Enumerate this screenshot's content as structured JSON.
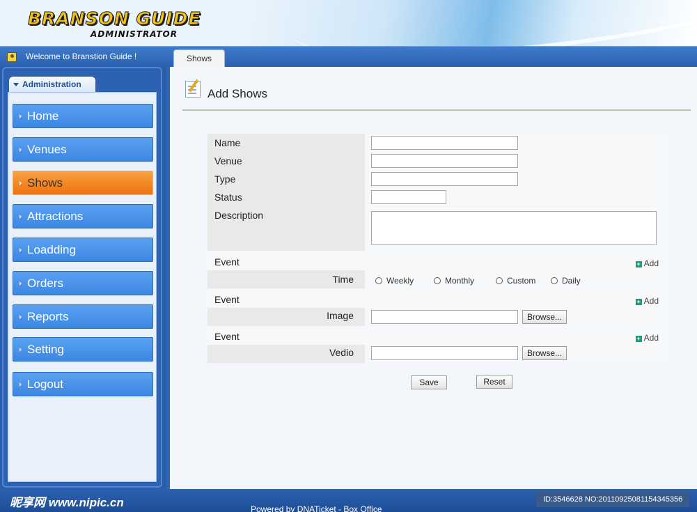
{
  "header": {
    "logo_main": "BRANSON GUIDE",
    "logo_sub": "ADMINISTRATOR"
  },
  "topbar": {
    "welcome": "Welcome to Branstion Guide !",
    "tab": "Shows"
  },
  "sidebar": {
    "section": "Administration",
    "items": [
      {
        "label": "Home",
        "active": false
      },
      {
        "label": "Venues",
        "active": false
      },
      {
        "label": "Shows",
        "active": true
      },
      {
        "label": "Attractions",
        "active": false
      },
      {
        "label": "Loadding",
        "active": false
      },
      {
        "label": "Orders",
        "active": false
      },
      {
        "label": "Reports",
        "active": false
      },
      {
        "label": "Setting",
        "active": false
      },
      {
        "label": "Logout",
        "active": false
      }
    ]
  },
  "main": {
    "title": "Add Shows",
    "fields": {
      "name": "Name",
      "venue": "Venue",
      "type": "Type",
      "status": "Status",
      "description": "Description"
    },
    "events": [
      {
        "label": "Event",
        "add": "Add",
        "sub_label": "Time",
        "options": [
          "Weekly",
          "Monthly",
          "Custom",
          "Daily"
        ]
      },
      {
        "label": "Event",
        "add": "Add",
        "sub_label": "Image",
        "browse": "Browse..."
      },
      {
        "label": "Event",
        "add": "Add",
        "sub_label": "Vedio",
        "browse": "Browse..."
      }
    ],
    "save": "Save",
    "reset": "Reset"
  },
  "footer": {
    "text": "Powered by DNATicket - Box Office",
    "watermark": "昵享网 www.nipic.cn",
    "id_strip": "ID:3546628 NO:20110925081154345356"
  },
  "colors": {
    "accent_blue": "#2a5ea8",
    "nav_blue": "#3c86e4",
    "active_orange": "#f48a25"
  }
}
